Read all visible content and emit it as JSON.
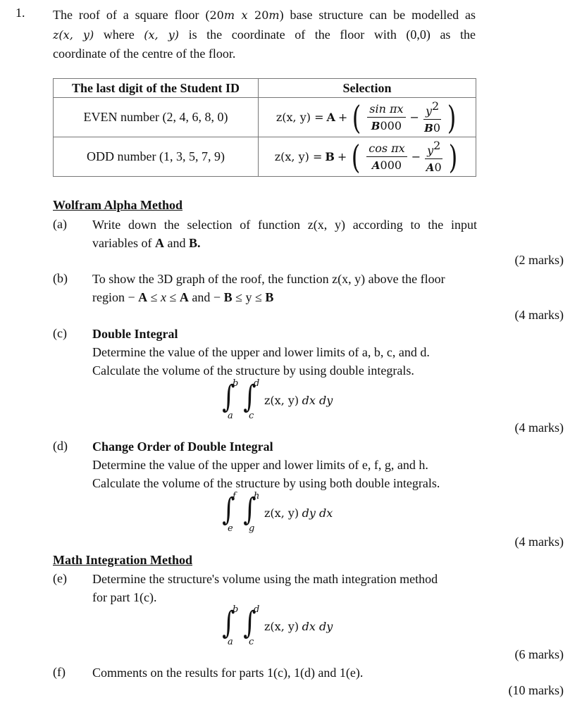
{
  "question": {
    "number": "1.",
    "intro_lines": [
      {
        "parts": [
          {
            "t": "The roof of a square floor ("
          },
          {
            "t": "20",
            "m": "m"
          },
          {
            "t": "m",
            "m": "mi"
          },
          {
            "t": " x ",
            "m": "mi"
          },
          {
            "t": "20",
            "m": "m"
          },
          {
            "t": "m",
            "m": "mi"
          },
          {
            "t": ") base structure can be modelled as"
          }
        ]
      },
      {
        "parts": [
          {
            "t": "z(x, y)",
            "m": "mi"
          },
          {
            "t": " where "
          },
          {
            "t": "(x,  y)",
            "m": "mi"
          },
          {
            "t": " is the coordinate of the floor with (0,0) as the"
          }
        ]
      },
      {
        "parts": [
          {
            "t": "coordinate of the centre of the floor."
          }
        ]
      }
    ]
  },
  "selection_table": {
    "headers": [
      "The last digit of the Student ID",
      "Selection"
    ],
    "rows": [
      {
        "digit": "EVEN number (2, 4, 6, 8, 0)",
        "lhs": "z(x, y) = ",
        "const": "A",
        "trig_num": "sin πx",
        "trig_den_var": "B",
        "trig_den_tail": "000",
        "minus": "−",
        "y_num": "y",
        "y_exp": "2",
        "y_den_var": "B",
        "y_den_tail": "0"
      },
      {
        "digit": "ODD number (1, 3, 5, 7, 9)",
        "lhs": "z(x, y) = ",
        "const": "B",
        "trig_num": "cos πx",
        "trig_den_var": "A",
        "trig_den_tail": "000",
        "minus": "−",
        "y_num": "y",
        "y_exp": "2",
        "y_den_var": "A",
        "y_den_tail": "0"
      }
    ]
  },
  "sections": {
    "wolfram": "Wolfram Alpha Method",
    "math": "Math Integration Method"
  },
  "parts": {
    "a": {
      "label": "(a)",
      "line1": "Write down the selection of function z(x, y) according to the input",
      "line2_pre": "variables of ",
      "A": "A",
      "and": " and ",
      "B": "B.",
      "marks": "(2 marks)"
    },
    "b": {
      "label": "(b)",
      "line1": "To show the 3D graph of the roof, the function z(x, y) above the floor",
      "line2": [
        "region − ",
        "A",
        " ≤ ",
        "x",
        " ≤ ",
        "A",
        " and − ",
        "B",
        " ≤ ",
        "y",
        " ≤ ",
        "B"
      ],
      "marks": "(4 marks)"
    },
    "c": {
      "label": "(c)",
      "title": "Double Integral",
      "line1": "Determine the value of the upper and lower limits of a, b, c, and d.",
      "line2": "Calculate the volume of the structure by using double integrals.",
      "integral": {
        "outer_lo": "a",
        "outer_hi": "b",
        "inner_lo": "c",
        "inner_hi": "d",
        "integrand": "z(x, y) ",
        "diff": "dx dy"
      },
      "marks": "(4 marks)"
    },
    "d": {
      "label": "(d)",
      "title": "Change Order of Double Integral",
      "line1": "Determine the value of the upper and lower limits of e, f, g, and h.",
      "line2": "Calculate the volume of the structure by using both double integrals.",
      "integral": {
        "outer_lo": "e",
        "outer_hi": "f",
        "inner_lo": "g",
        "inner_hi": "h",
        "integrand": "z(x, y) ",
        "diff": "dy dx"
      },
      "marks": "(4 marks)"
    },
    "e": {
      "label": "(e)",
      "line1": "Determine the structure's volume using the math integration method",
      "line2": "for part 1(c).",
      "integral": {
        "outer_lo": "a",
        "outer_hi": "b",
        "inner_lo": "c",
        "inner_hi": "d",
        "integrand": "z(x, y) ",
        "diff": "dx dy"
      },
      "marks": "(6 marks)"
    },
    "f": {
      "label": "(f)",
      "line1": "Comments on the results for parts 1(c), 1(d) and 1(e).",
      "marks": "(10 marks)"
    }
  }
}
